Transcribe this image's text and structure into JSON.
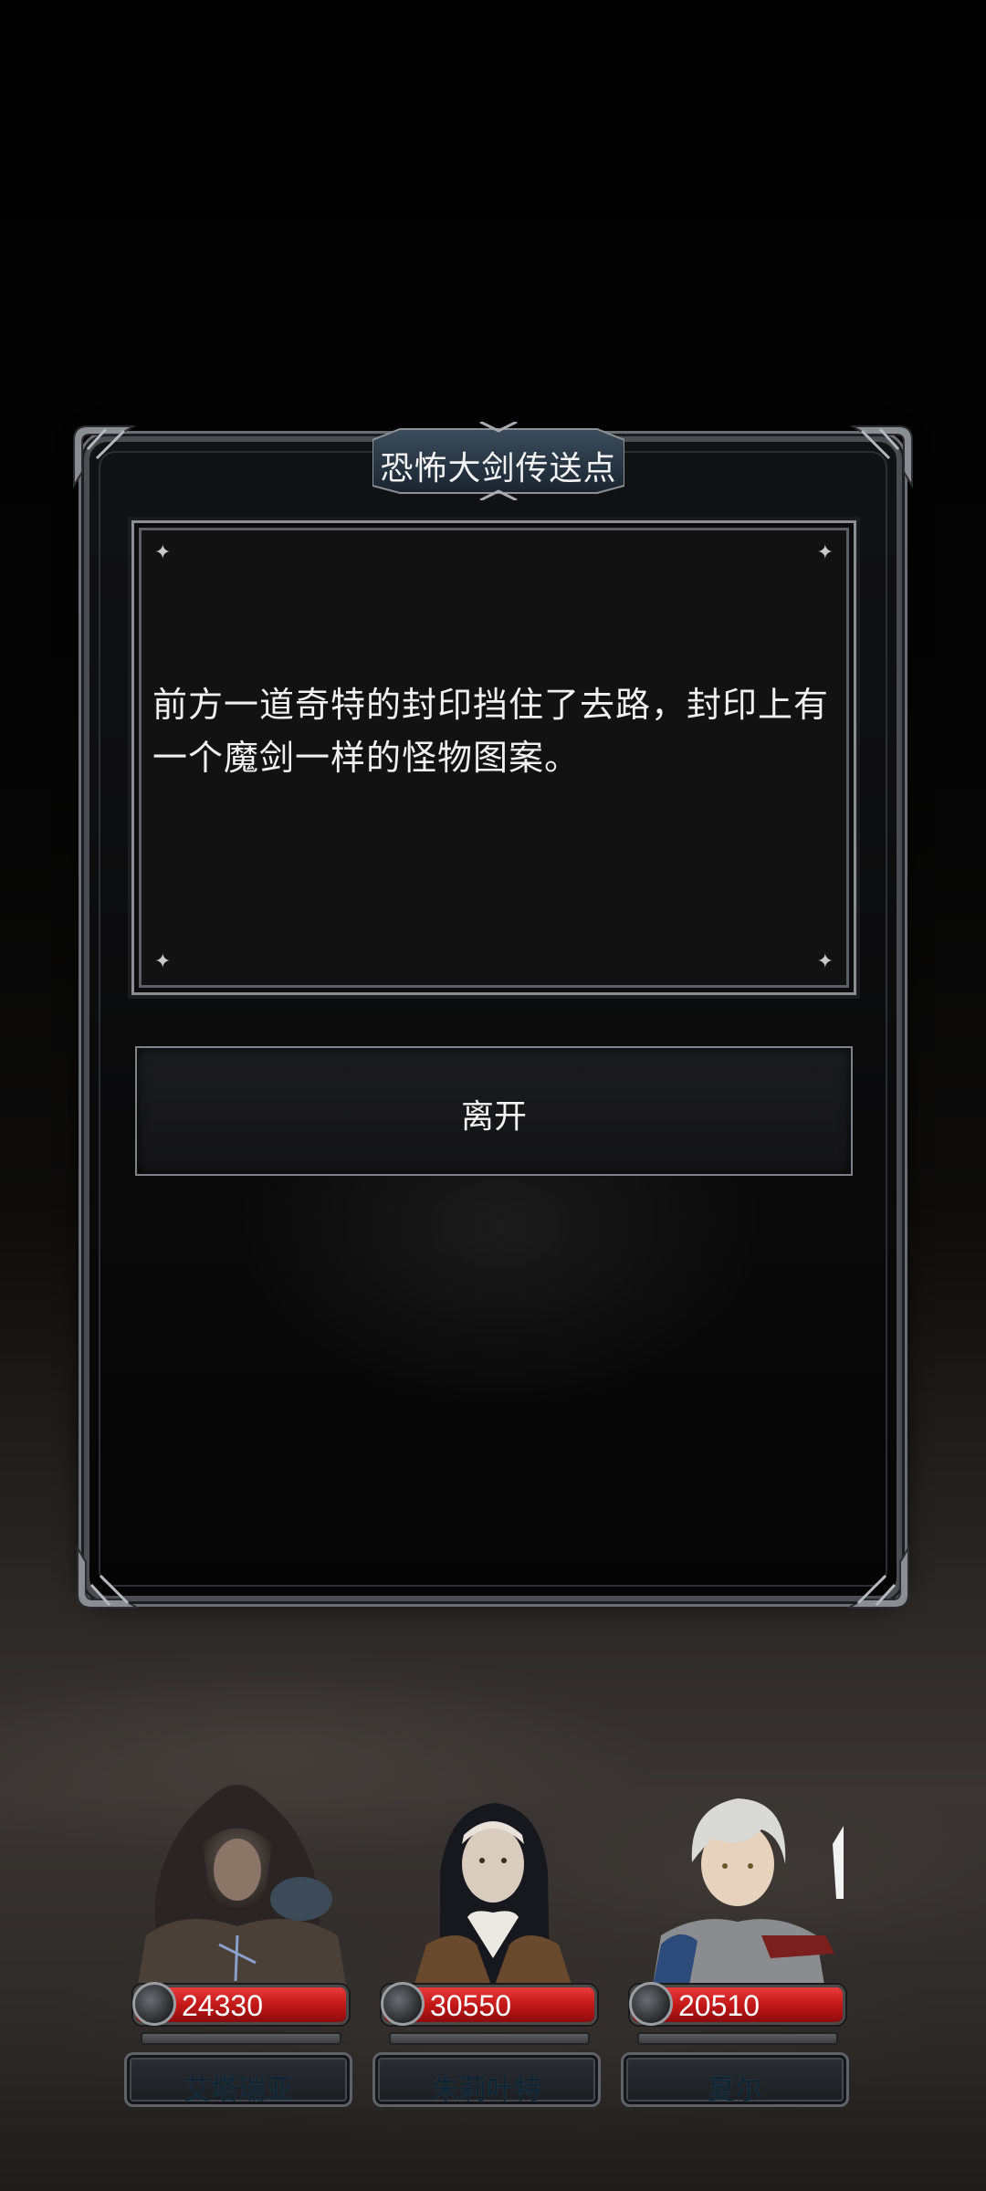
{
  "dialog": {
    "title": "恐怖大剑传送点",
    "message": "前方一道奇特的封印挡住了去路，封印上有一个魔剑一样的怪物图案。",
    "leave_label": "离开"
  },
  "party": [
    {
      "power": "24330",
      "name": "艾塔瑞亚",
      "portrait": "hooded-woman-portrait"
    },
    {
      "power": "30550",
      "name": "朱莉叶特",
      "portrait": "nun-portrait"
    },
    {
      "power": "20510",
      "name": "夏尔",
      "portrait": "silver-haired-knight-portrait"
    }
  ],
  "colors": {
    "power_bar": "#c41818",
    "panel_border": "#8b8e93",
    "text": "#f0f0f0"
  }
}
